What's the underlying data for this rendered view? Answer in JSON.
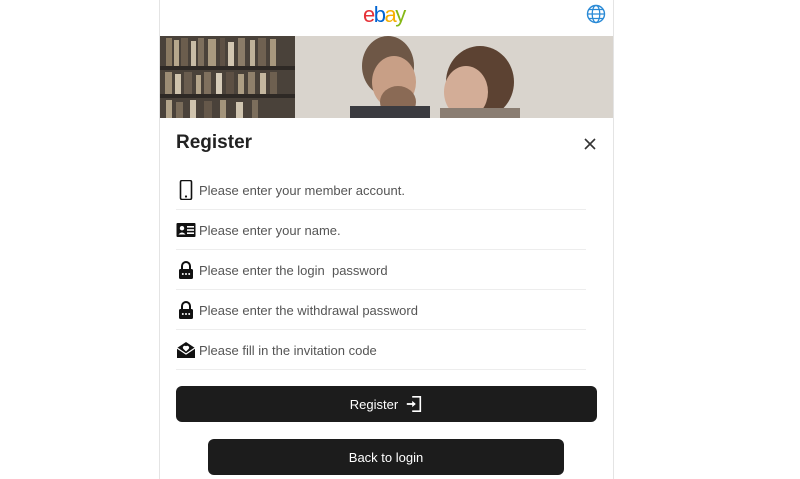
{
  "header": {
    "logo_parts": [
      "e",
      "b",
      "a",
      "y"
    ],
    "logo_colors": [
      "#e53238",
      "#0064d2",
      "#f5af02",
      "#86b817"
    ],
    "language_icon": "globe-icon"
  },
  "banner": {
    "image": "couple-photo"
  },
  "form": {
    "title": "Register",
    "close_icon": "close-icon",
    "fields": [
      {
        "icon": "phone-icon",
        "placeholder": "Please enter your member account."
      },
      {
        "icon": "id-card-icon",
        "placeholder": "Please enter your name."
      },
      {
        "icon": "lock-icon",
        "placeholder": "Please enter the login  password"
      },
      {
        "icon": "lock-icon",
        "placeholder": "Please enter the withdrawal password"
      },
      {
        "icon": "invite-mail-icon",
        "placeholder": "Please fill in the invitation code"
      }
    ],
    "register_label": "Register",
    "register_icon": "sign-in-icon",
    "back_label": "Back to login"
  },
  "colors": {
    "button_bg": "#1c1c1c",
    "accent_blue": "#0064d2"
  }
}
